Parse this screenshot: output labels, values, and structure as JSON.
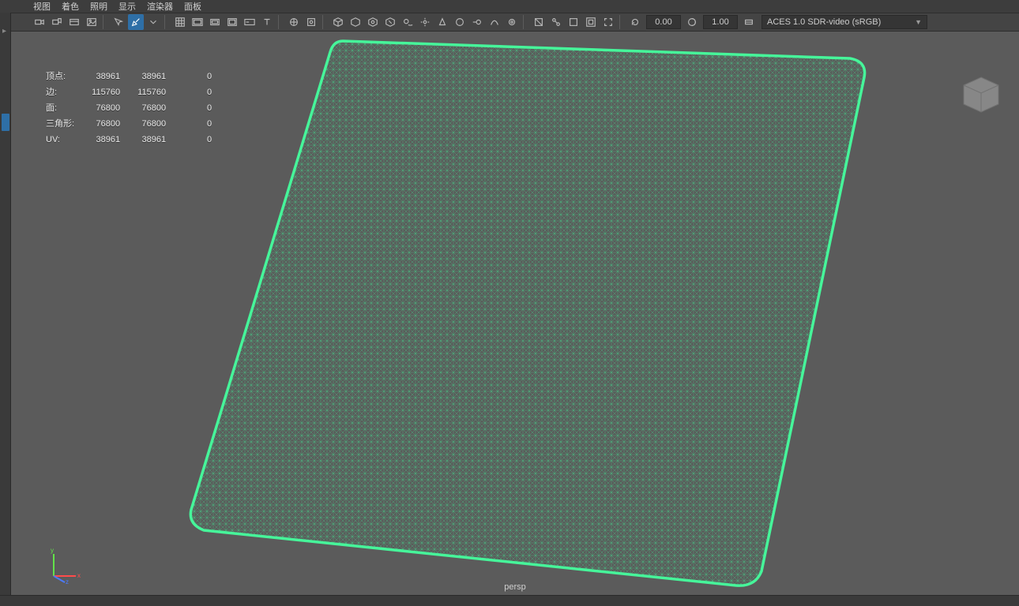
{
  "menubar": {
    "items": [
      "视图",
      "着色",
      "照明",
      "显示",
      "渲染器",
      "面板"
    ]
  },
  "toolbar": {
    "values": {
      "rotate": "0.00",
      "scale": "1.00"
    },
    "colorspace": "ACES 1.0 SDR-video (sRGB)"
  },
  "stats": {
    "headers": [
      "",
      "",
      "",
      ""
    ],
    "rows": [
      {
        "label": "顶点:",
        "a": "38961",
        "b": "38961",
        "c": "0"
      },
      {
        "label": "边:",
        "a": "115760",
        "b": "115760",
        "c": "0"
      },
      {
        "label": "面:",
        "a": "76800",
        "b": "76800",
        "c": "0"
      },
      {
        "label": "三角形:",
        "a": "76800",
        "b": "76800",
        "c": "0"
      },
      {
        "label": "UV:",
        "a": "38961",
        "b": "38961",
        "c": "0"
      }
    ]
  },
  "camera": {
    "label": "persp"
  },
  "axes": {
    "x": "x",
    "y": "y",
    "z": "z"
  }
}
